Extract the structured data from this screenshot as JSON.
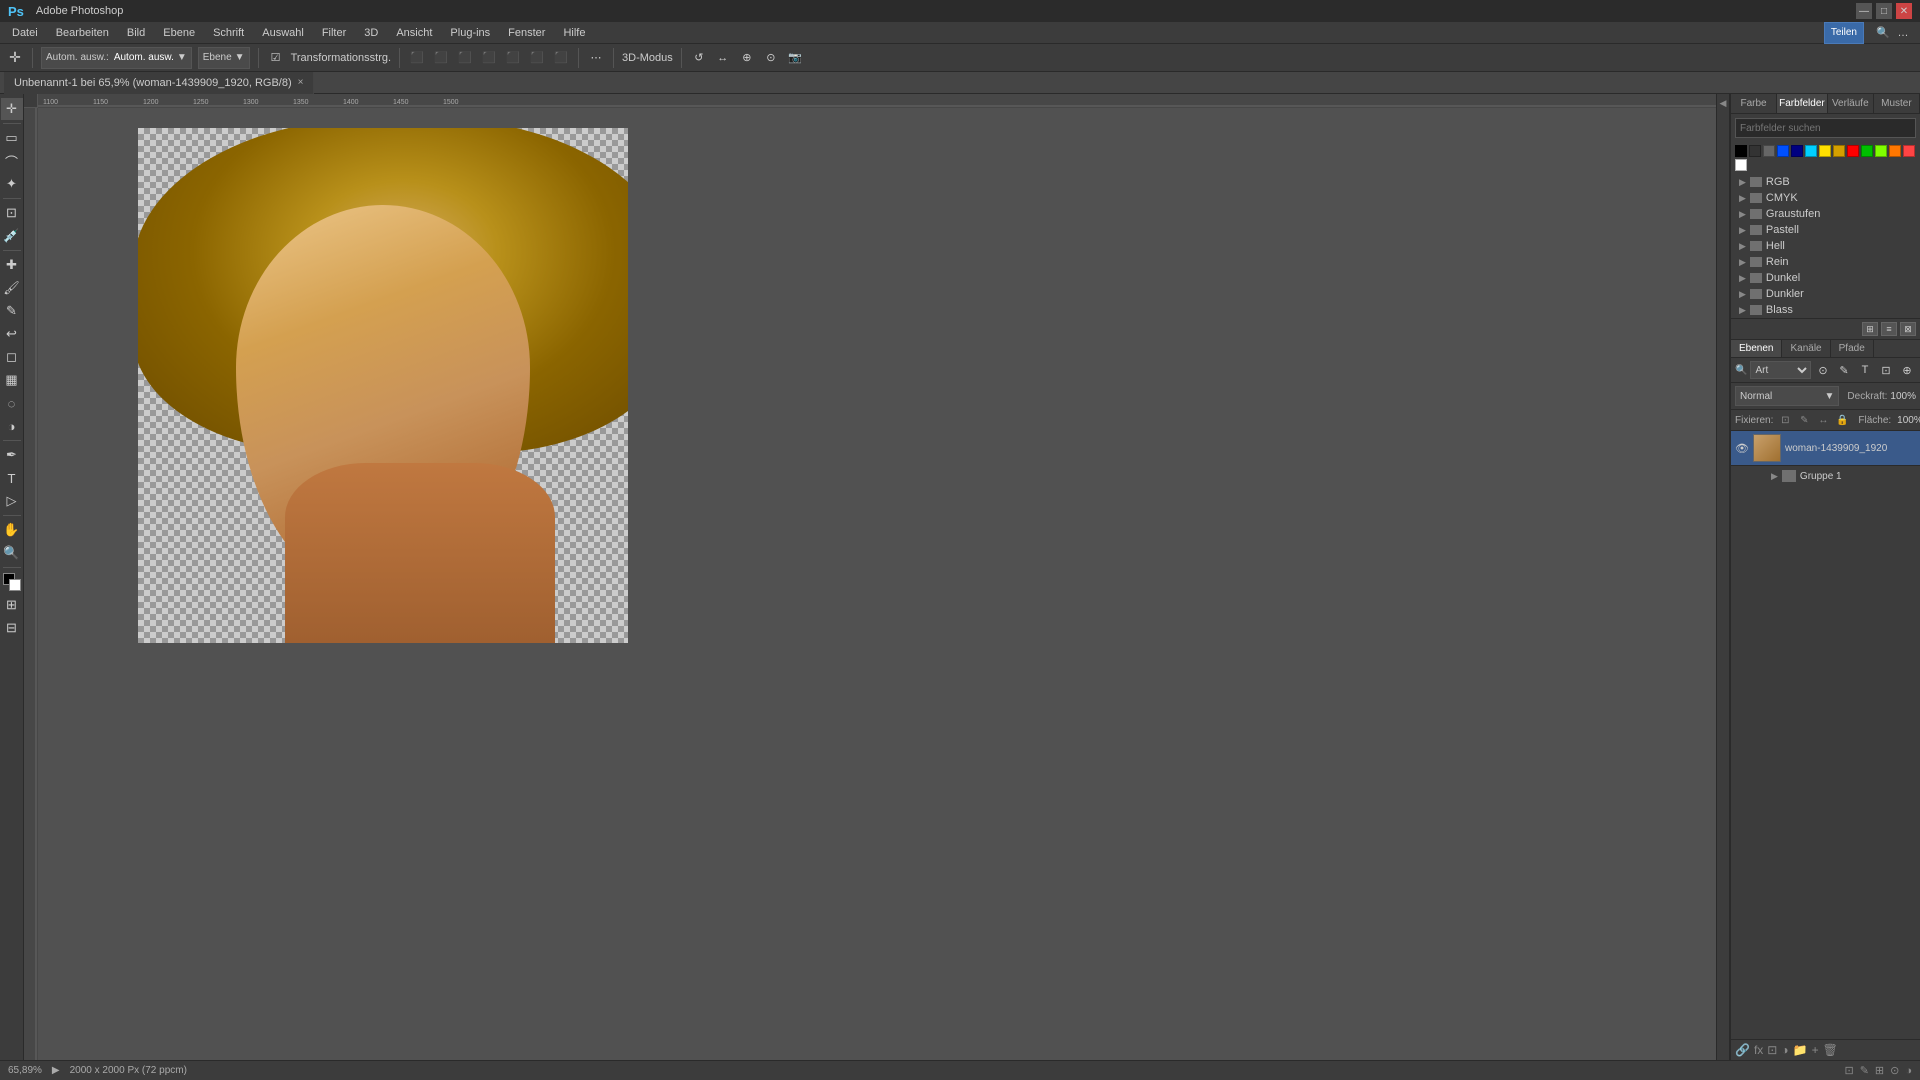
{
  "titlebar": {
    "title": "Adobe Photoshop",
    "app_label": "Ps",
    "controls": [
      "—",
      "□",
      "✕"
    ]
  },
  "menubar": {
    "items": [
      "Datei",
      "Bearbeiten",
      "Bild",
      "Ebene",
      "Schrift",
      "Auswahl",
      "Filter",
      "3D",
      "Ansicht",
      "Plug-ins",
      "Fenster",
      "Hilfe"
    ]
  },
  "optionsbar": {
    "autom_label": "Autom. ausw.:",
    "ebene_label": "Ebene",
    "transformationsstrg_label": "Transformationsstrg.",
    "mode_label": "3D-Modus"
  },
  "tabbar": {
    "tab_label": "Unbenannt-1 bei 65,9% (woman-1439909_1920, RGB/8)",
    "tab_close": "×"
  },
  "color_panel": {
    "tabs": [
      "Farbe",
      "Farbfelder",
      "Verläufe",
      "Muster"
    ],
    "active_tab": "Farbfelder",
    "search_placeholder": "Farbfelder suchen",
    "swatches": [
      "black",
      "darkgray",
      "blue",
      "cyan",
      "yellow",
      "darkyellow",
      "red",
      "green",
      "lime",
      "orange",
      "pink",
      "white",
      "lightred"
    ],
    "groups": [
      {
        "label": "RGB"
      },
      {
        "label": "CMYK"
      },
      {
        "label": "Graustufen"
      },
      {
        "label": "Pastell"
      },
      {
        "label": "Hell"
      },
      {
        "label": "Rein"
      },
      {
        "label": "Dunkel"
      },
      {
        "label": "Dunkler"
      },
      {
        "label": "Blass"
      }
    ]
  },
  "layers_panel": {
    "tabs": [
      "Ebenen",
      "Kanäle",
      "Pfade"
    ],
    "active_tab": "Ebenen",
    "search_placeholder": "Art",
    "blend_mode": "Normal",
    "blend_arrow": "▼",
    "opacity_label": "Deckraft:",
    "opacity_value": "100%",
    "flaehe_label": "Fläche:",
    "flaehe_value": "100%",
    "fixieren_label": "Fixieren:",
    "layer1_name": "woman-1439909_1920",
    "layer1_visible": true,
    "group1_name": "Gruppe 1",
    "lock_icons": [
      "🔒",
      "📌",
      "↔",
      "🔗",
      "🔒"
    ]
  },
  "statusbar": {
    "zoom": "65,89%",
    "dimensions": "2000 x 2000 Px (72 ppcm)",
    "arrow": "▶"
  },
  "canvas": {
    "bg_color": "#515151"
  }
}
